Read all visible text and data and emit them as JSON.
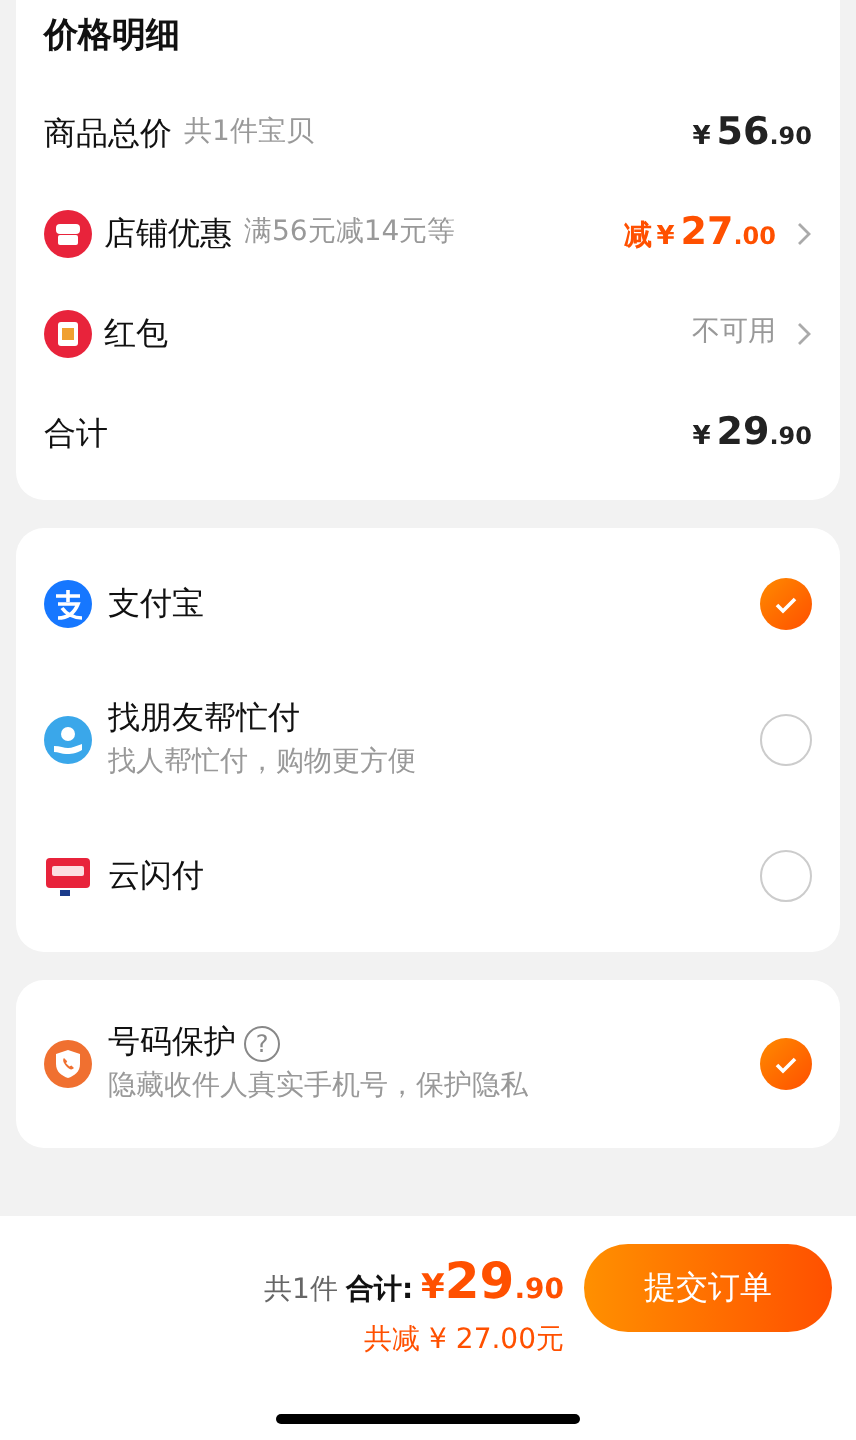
{
  "price_detail": {
    "title": "价格明细",
    "rows": [
      {
        "kind": "plain",
        "label": "商品总价",
        "note": "共1件宝贝",
        "price": {
          "symbol": "¥",
          "integer": "56",
          "decimal": ".90"
        },
        "chevron": false
      },
      {
        "kind": "shop",
        "label": "店铺优惠",
        "note": "满56元减14元等",
        "price": {
          "prefix": "减",
          "symbol": "¥",
          "integer": "27",
          "decimal": ".00"
        },
        "chevron": true,
        "discount": true
      },
      {
        "kind": "redpacket",
        "label": "红包",
        "status": "不可用",
        "chevron": true
      },
      {
        "kind": "plain",
        "label": "合计",
        "price": {
          "symbol": "¥",
          "integer": "29",
          "decimal": ".90"
        },
        "chevron": false
      }
    ]
  },
  "payment_methods": [
    {
      "kind": "alipay",
      "label": "支付宝",
      "selected": true
    },
    {
      "kind": "friend",
      "label": "找朋友帮忙付",
      "subtitle": "找人帮忙付，购物更方便",
      "selected": false
    },
    {
      "kind": "unionpay",
      "label": "云闪付",
      "selected": false
    }
  ],
  "number_protection": {
    "label": "号码保护",
    "help": "?",
    "subtitle": "隐藏收件人真实手机号，保护隐私",
    "checked": true
  },
  "footer": {
    "count": "共1件",
    "total_label": "合计:",
    "symbol": "¥",
    "integer": "29",
    "decimal": ".90",
    "discount": "共减 ¥ 27.00元",
    "submit": "提交订单"
  }
}
